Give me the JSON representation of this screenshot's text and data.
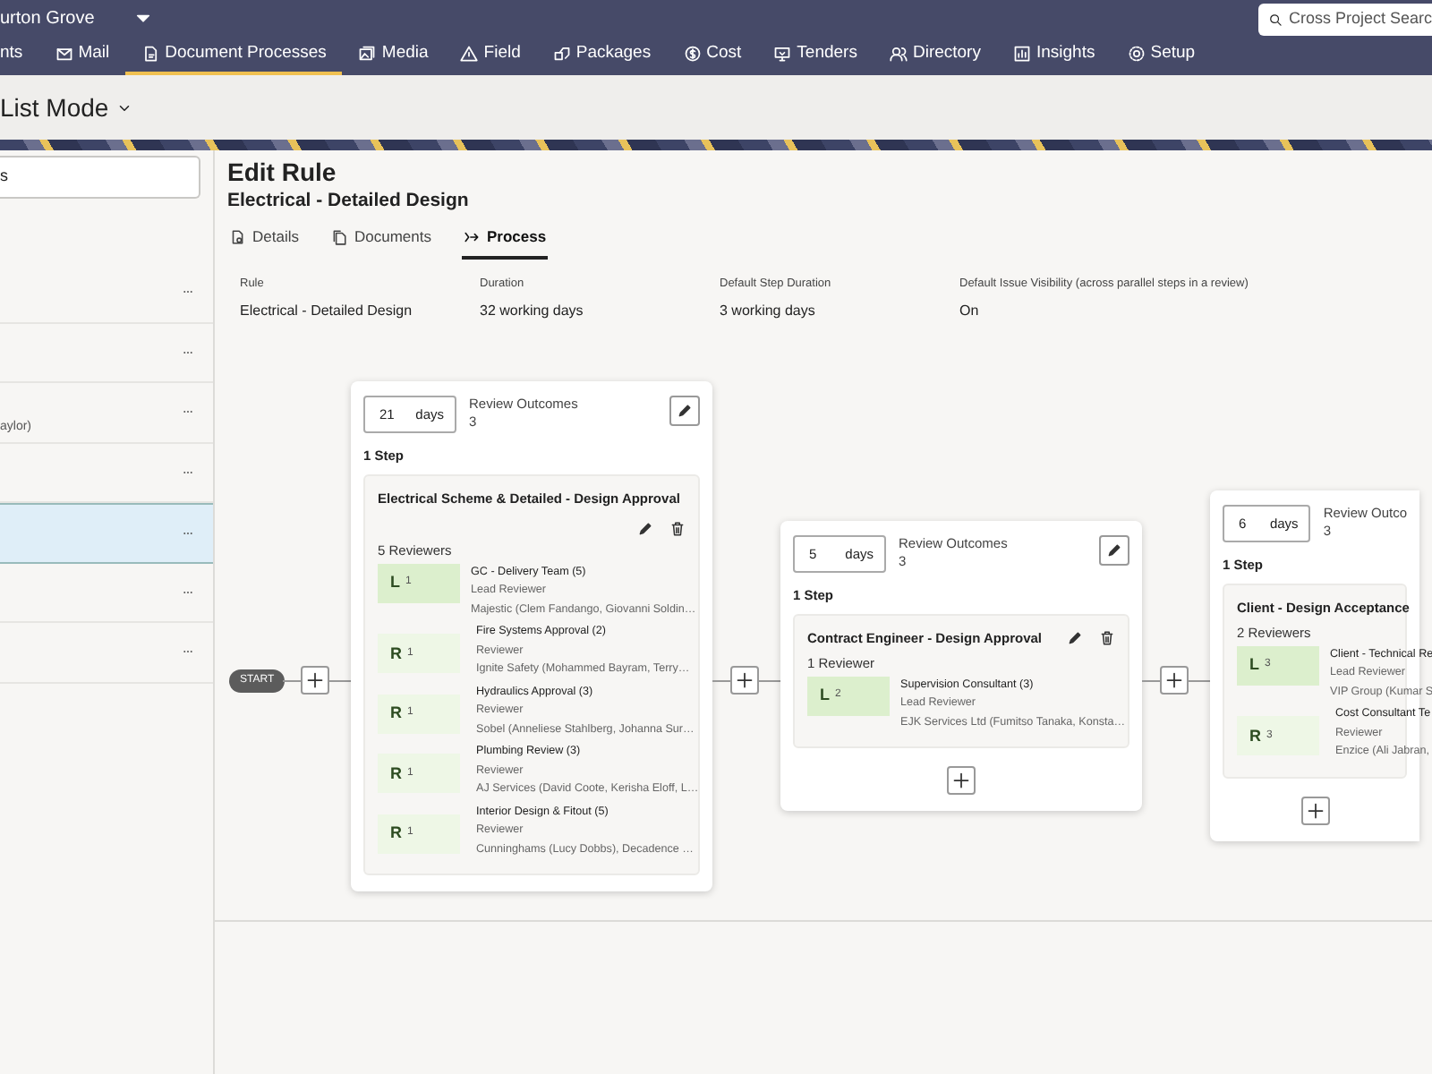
{
  "project": {
    "name": "urton Grove"
  },
  "search": {
    "placeholder": "Cross Project Searc"
  },
  "nav": [
    {
      "label": "nts",
      "selected": false
    },
    {
      "label": "Mail",
      "selected": false
    },
    {
      "label": "Document Processes",
      "selected": true
    },
    {
      "label": "Media",
      "selected": false
    },
    {
      "label": "Field",
      "selected": false
    },
    {
      "label": "Packages",
      "selected": false
    },
    {
      "label": "Cost",
      "selected": false
    },
    {
      "label": "Tenders",
      "selected": false
    },
    {
      "label": "Directory",
      "selected": false
    },
    {
      "label": "Insights",
      "selected": false
    },
    {
      "label": "Setup",
      "selected": false
    }
  ],
  "header": {
    "title": "List Mode"
  },
  "sidebar": {
    "search": {
      "value": "s"
    },
    "items": [
      {
        "selected": false
      },
      {
        "selected": false
      },
      {
        "selected": false,
        "detail": "aylor)"
      },
      {
        "selected": false
      },
      {
        "selected": true
      },
      {
        "selected": false
      },
      {
        "selected": false
      }
    ]
  },
  "rule": {
    "title": "Edit Rule",
    "subtitle": "Electrical - Detailed Design",
    "tabs": [
      {
        "label": "Details",
        "selected": false
      },
      {
        "label": "Documents",
        "selected": false
      },
      {
        "label": "Process",
        "selected": true
      }
    ],
    "fields": [
      {
        "label": "Rule",
        "value": "Electrical - Detailed Design"
      },
      {
        "label": "Duration",
        "value": "32 working days"
      },
      {
        "label": "Default Step Duration",
        "value": "3 working days"
      },
      {
        "label": "Default Issue Visibility (across parallel steps in a review)",
        "value": "On"
      }
    ]
  },
  "process": {
    "start_label": "START",
    "stages": [
      {
        "days": "21",
        "days_unit": "days",
        "outcomes_label": "Review Outcomes",
        "outcomes": "3",
        "edit_button": true,
        "add_button": false,
        "steps_label": "1 Step",
        "steps": [
          {
            "title": "Electrical Scheme & Detailed - Design Approval",
            "actions": true,
            "reviewers_label": "5 Reviewers",
            "reviewers": [
              {
                "kind": "lead",
                "letter": "L",
                "count": "1",
                "name": "GC - Delivery Team (5)",
                "role": "Lead Reviewer",
                "members": "Majestic (Clem Fandango, Giovanni Soldin…"
              },
              {
                "kind": "reviewer",
                "letter": "R",
                "count": "1",
                "name": "Fire Systems Approval (2)",
                "role": "Reviewer",
                "members": "Ignite Safety (Mohammed Bayram, Terry…"
              },
              {
                "kind": "reviewer",
                "letter": "R",
                "count": "1",
                "name": "Hydraulics Approval (3)",
                "role": "Reviewer",
                "members": "Sobel (Anneliese Stahlberg, Johanna Sur…"
              },
              {
                "kind": "reviewer",
                "letter": "R",
                "count": "1",
                "name": "Plumbing Review (3)",
                "role": "Reviewer",
                "members": "AJ Services (David Coote, Kerisha Eloff, L…"
              },
              {
                "kind": "reviewer",
                "letter": "R",
                "count": "1",
                "name": "Interior Design & Fitout (5)",
                "role": "Reviewer",
                "members": "Cunninghams (Lucy Dobbs), Decadence …"
              }
            ]
          }
        ]
      },
      {
        "days": "5",
        "days_unit": "days",
        "outcomes_label": "Review Outcomes",
        "outcomes": "3",
        "edit_button": true,
        "add_button": true,
        "steps_label": "1 Step",
        "steps": [
          {
            "title": "Contract Engineer - Design Approval",
            "actions": true,
            "reviewers_label": "1 Reviewer",
            "reviewers": [
              {
                "kind": "lead",
                "letter": "L",
                "count": "2",
                "name": "Supervision Consultant (3)",
                "role": "Lead Reviewer",
                "members": "EJK Services Ltd (Fumitso Tanaka, Konsta…"
              }
            ]
          }
        ]
      },
      {
        "days": "6",
        "days_unit": "days",
        "outcomes_label": "Review Outco",
        "outcomes": "3",
        "edit_button": false,
        "add_button": true,
        "steps_label": "1 Step",
        "steps": [
          {
            "title": "Client - Design Acceptance",
            "actions": false,
            "reviewers_label": "2 Reviewers",
            "reviewers": [
              {
                "kind": "lead",
                "letter": "L",
                "count": "3",
                "name": "Client - Technical Re",
                "role": "Lead Reviewer",
                "members": "VIP Group (Kumar S"
              },
              {
                "kind": "reviewer",
                "letter": "R",
                "count": "3",
                "name": "Cost Consultant Te",
                "role": "Reviewer",
                "members": "Enzice (Ali Jabran, "
              }
            ]
          }
        ]
      }
    ]
  }
}
